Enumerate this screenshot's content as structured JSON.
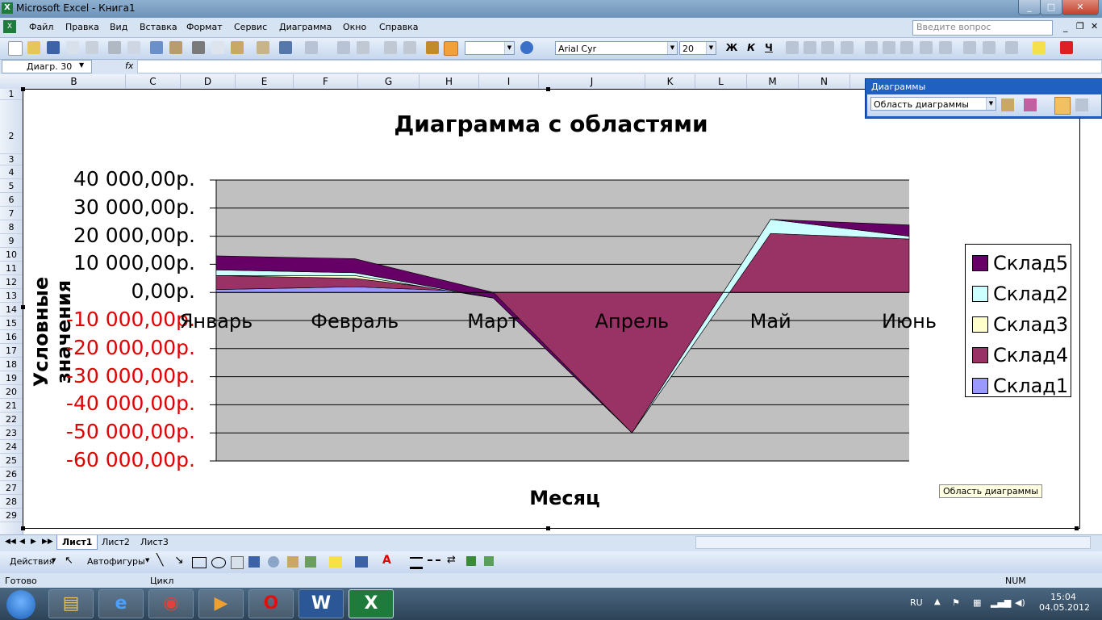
{
  "window": {
    "title": "Microsoft Excel - Книга1"
  },
  "menu": [
    "Файл",
    "Правка",
    "Вид",
    "Вставка",
    "Формат",
    "Сервис",
    "Диаграмма",
    "Окно",
    "Справка"
  ],
  "ask_placeholder": "Введите вопрос",
  "toolbar": {
    "font_name": "Arial Cyr",
    "font_size": "20",
    "bold": "Ж",
    "italic": "К",
    "underline": "Ч"
  },
  "formula_bar": {
    "name_box": "Диагр. 30",
    "fx": "fx"
  },
  "columns": [
    "B",
    "C",
    "D",
    "E",
    "F",
    "G",
    "H",
    "I",
    "J",
    "K",
    "L",
    "M",
    "N"
  ],
  "rows": [
    "1",
    "2",
    "3",
    "4",
    "5",
    "6",
    "7",
    "8",
    "9",
    "10",
    "11",
    "12",
    "13",
    "14",
    "15",
    "16",
    "17",
    "18",
    "19",
    "20",
    "21",
    "22",
    "23",
    "24",
    "25",
    "26",
    "27",
    "28",
    "29"
  ],
  "chart_toolbar": {
    "title": "Диаграммы",
    "element": "Область диаграммы"
  },
  "tooltip": "Область диаграммы",
  "chart_data": {
    "type": "area",
    "title": "Диаграмма с областями",
    "xlabel": "Месяц",
    "ylabel": "Условные значения",
    "categories": [
      "Январь",
      "Февраль",
      "Март",
      "Апрель",
      "Май",
      "Июнь"
    ],
    "yticks": [
      "40 000,00р.",
      "30 000,00р.",
      "20 000,00р.",
      "10 000,00р.",
      "0,00р.",
      "-10 000,00р.",
      "-20 000,00р.",
      "-30 000,00р.",
      "-40 000,00р.",
      "-50 000,00р.",
      "-60 000,00р."
    ],
    "ylim": [
      -60000,
      40000
    ],
    "series": [
      {
        "name": "Склад1",
        "values": [
          1000,
          2000,
          0,
          0,
          0,
          0
        ],
        "color": "#9999ff"
      },
      {
        "name": "Склад4",
        "values": [
          5000,
          3000,
          -1000,
          -50000,
          21000,
          19000
        ],
        "color": "#993366"
      },
      {
        "name": "Склад3",
        "values": [
          0,
          1000,
          -1000,
          0,
          0,
          0
        ],
        "color": "#ffffcc"
      },
      {
        "name": "Склад2",
        "values": [
          2000,
          1000,
          0,
          0,
          5000,
          1000
        ],
        "color": "#ccffff"
      },
      {
        "name": "Склад5",
        "values": [
          5000,
          5000,
          2000,
          0,
          0,
          4000
        ],
        "color": "#660066"
      }
    ],
    "legend_order": [
      "Склад5",
      "Склад2",
      "Склад3",
      "Склад4",
      "Склад1"
    ],
    "legend_position": "right",
    "grid": true,
    "plot_bg": "#c0c0c0",
    "negative_tick_color": "#e00000"
  },
  "sheets": [
    "Лист1",
    "Лист2",
    "Лист3"
  ],
  "drawing": {
    "actions": "Действия",
    "autoshapes": "Автофигуры"
  },
  "status": {
    "left": "Готово",
    "mid": "Цикл",
    "num": "NUM"
  },
  "tray": {
    "lang": "RU",
    "time": "15:04",
    "date": "04.05.2012"
  }
}
